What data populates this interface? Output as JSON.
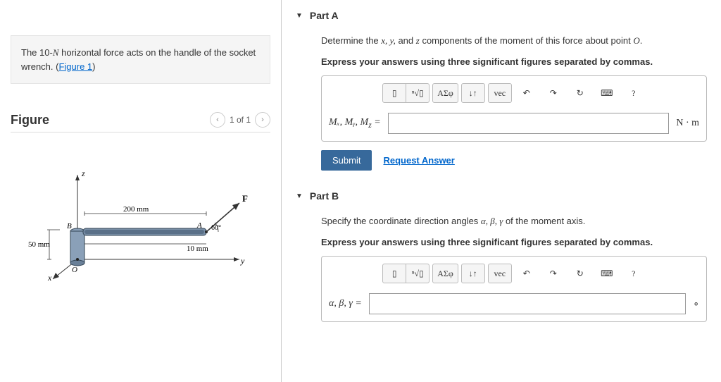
{
  "problem": {
    "text_pre": "The 10-",
    "text_force_unit": "N",
    "text_post1": " horizontal force acts on the handle of the socket wrench. (",
    "figure_link": "Figure 1",
    "text_post2": ")"
  },
  "figure": {
    "heading": "Figure",
    "counter": "1 of 1",
    "labels": {
      "z": "z",
      "y": "y",
      "x": "x",
      "F": "F",
      "A": "A",
      "B": "B",
      "O": "O",
      "d1": "200 mm",
      "d2": "10 mm",
      "d3": "50 mm",
      "angle": "60°"
    }
  },
  "partA": {
    "title": "Part A",
    "prompt_pre": "Determine the ",
    "prompt_vars": "x, y,",
    "prompt_mid": " and ",
    "prompt_var_z": "z",
    "prompt_mid2": " components of the moment of this force about point ",
    "prompt_pointO": "O",
    "prompt_post": ".",
    "instructions": "Express your answers using three significant figures separated by commas.",
    "var_label": "Mₓ, Mᵧ, M",
    "var_label_sub": "z",
    "equals": " =",
    "unit": "N · m",
    "submit": "Submit",
    "request": "Request Answer"
  },
  "partB": {
    "title": "Part B",
    "prompt_pre": "Specify the coordinate direction angles ",
    "prompt_vars": "α, β, γ",
    "prompt_post": " of the moment axis.",
    "instructions": "Express your answers using three significant figures separated by commas.",
    "var_label": "α, β, γ =",
    "unit": "∘"
  },
  "toolbar": {
    "templates": "▯",
    "sqrt": "ⁿ√▯",
    "greek": "ΑΣφ",
    "subs": "↓↑",
    "vec": "vec",
    "undo": "↶",
    "redo": "↷",
    "reset": "↻",
    "keyboard": "⌨",
    "help": "?"
  }
}
